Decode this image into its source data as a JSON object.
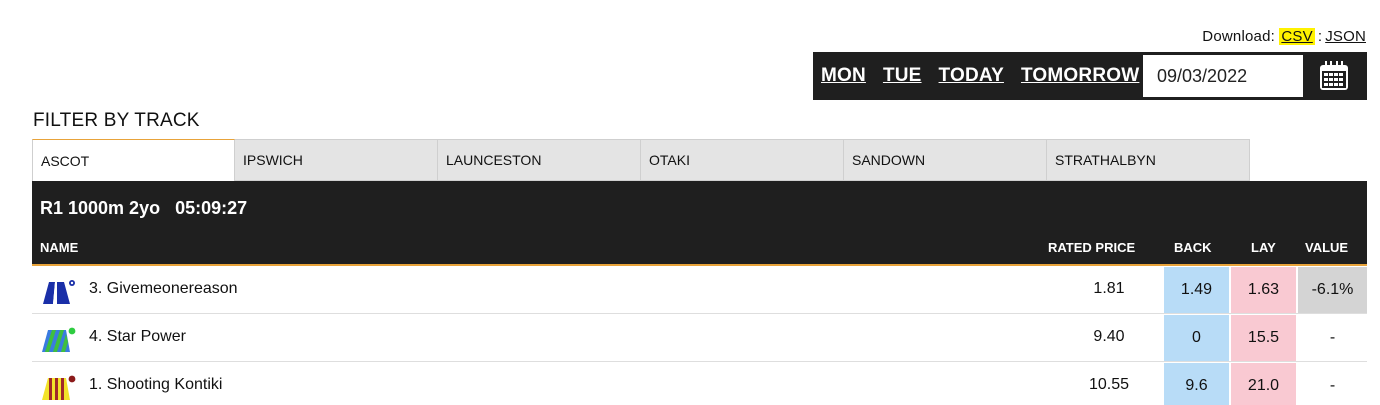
{
  "download": {
    "label": "Download:",
    "csv": "CSV",
    "sep": ":",
    "json": "JSON"
  },
  "days": [
    "MON",
    "TUE",
    "TODAY",
    "TOMORROW"
  ],
  "date_value": "09/03/2022",
  "filter_title": "FILTER BY TRACK",
  "tracks": [
    "ASCOT",
    "IPSWICH",
    "LAUNCESTON",
    "OTAKI",
    "SANDOWN",
    "STRATHALBYN"
  ],
  "active_track": "ASCOT",
  "race": {
    "title": "R1 1000m 2yo   05:09:27"
  },
  "columns": {
    "name": "NAME",
    "rated": "RATED PRICE",
    "back": "BACK",
    "lay": "LAY",
    "value": "VALUE"
  },
  "runners": [
    {
      "name": "3. Givemeonereason",
      "rated": "1.81",
      "back": "1.49",
      "lay": "1.63",
      "value": "-6.1%",
      "silk": {
        "body": "#1a2fa8",
        "accent": "#ffffff",
        "cap": "#1a2fa8"
      }
    },
    {
      "name": "4. Star Power",
      "rated": "9.40",
      "back": "0",
      "lay": "15.5",
      "value": "-",
      "silk": {
        "body": "#3a7be0",
        "accent": "#3fbf3f",
        "cap": "#2ecc40"
      }
    },
    {
      "name": "1. Shooting Kontiki",
      "rated": "10.55",
      "back": "9.6",
      "lay": "21.0",
      "value": "-",
      "silk": {
        "body": "#f2e22a",
        "accent": "#a0282a",
        "cap": "#8b1a1a"
      }
    }
  ],
  "colors": {
    "dark": "#1f1f1f",
    "accent": "#e8a33a",
    "back": "#b8dcf7",
    "lay": "#f9c9d2",
    "highlight": "#fff200"
  }
}
